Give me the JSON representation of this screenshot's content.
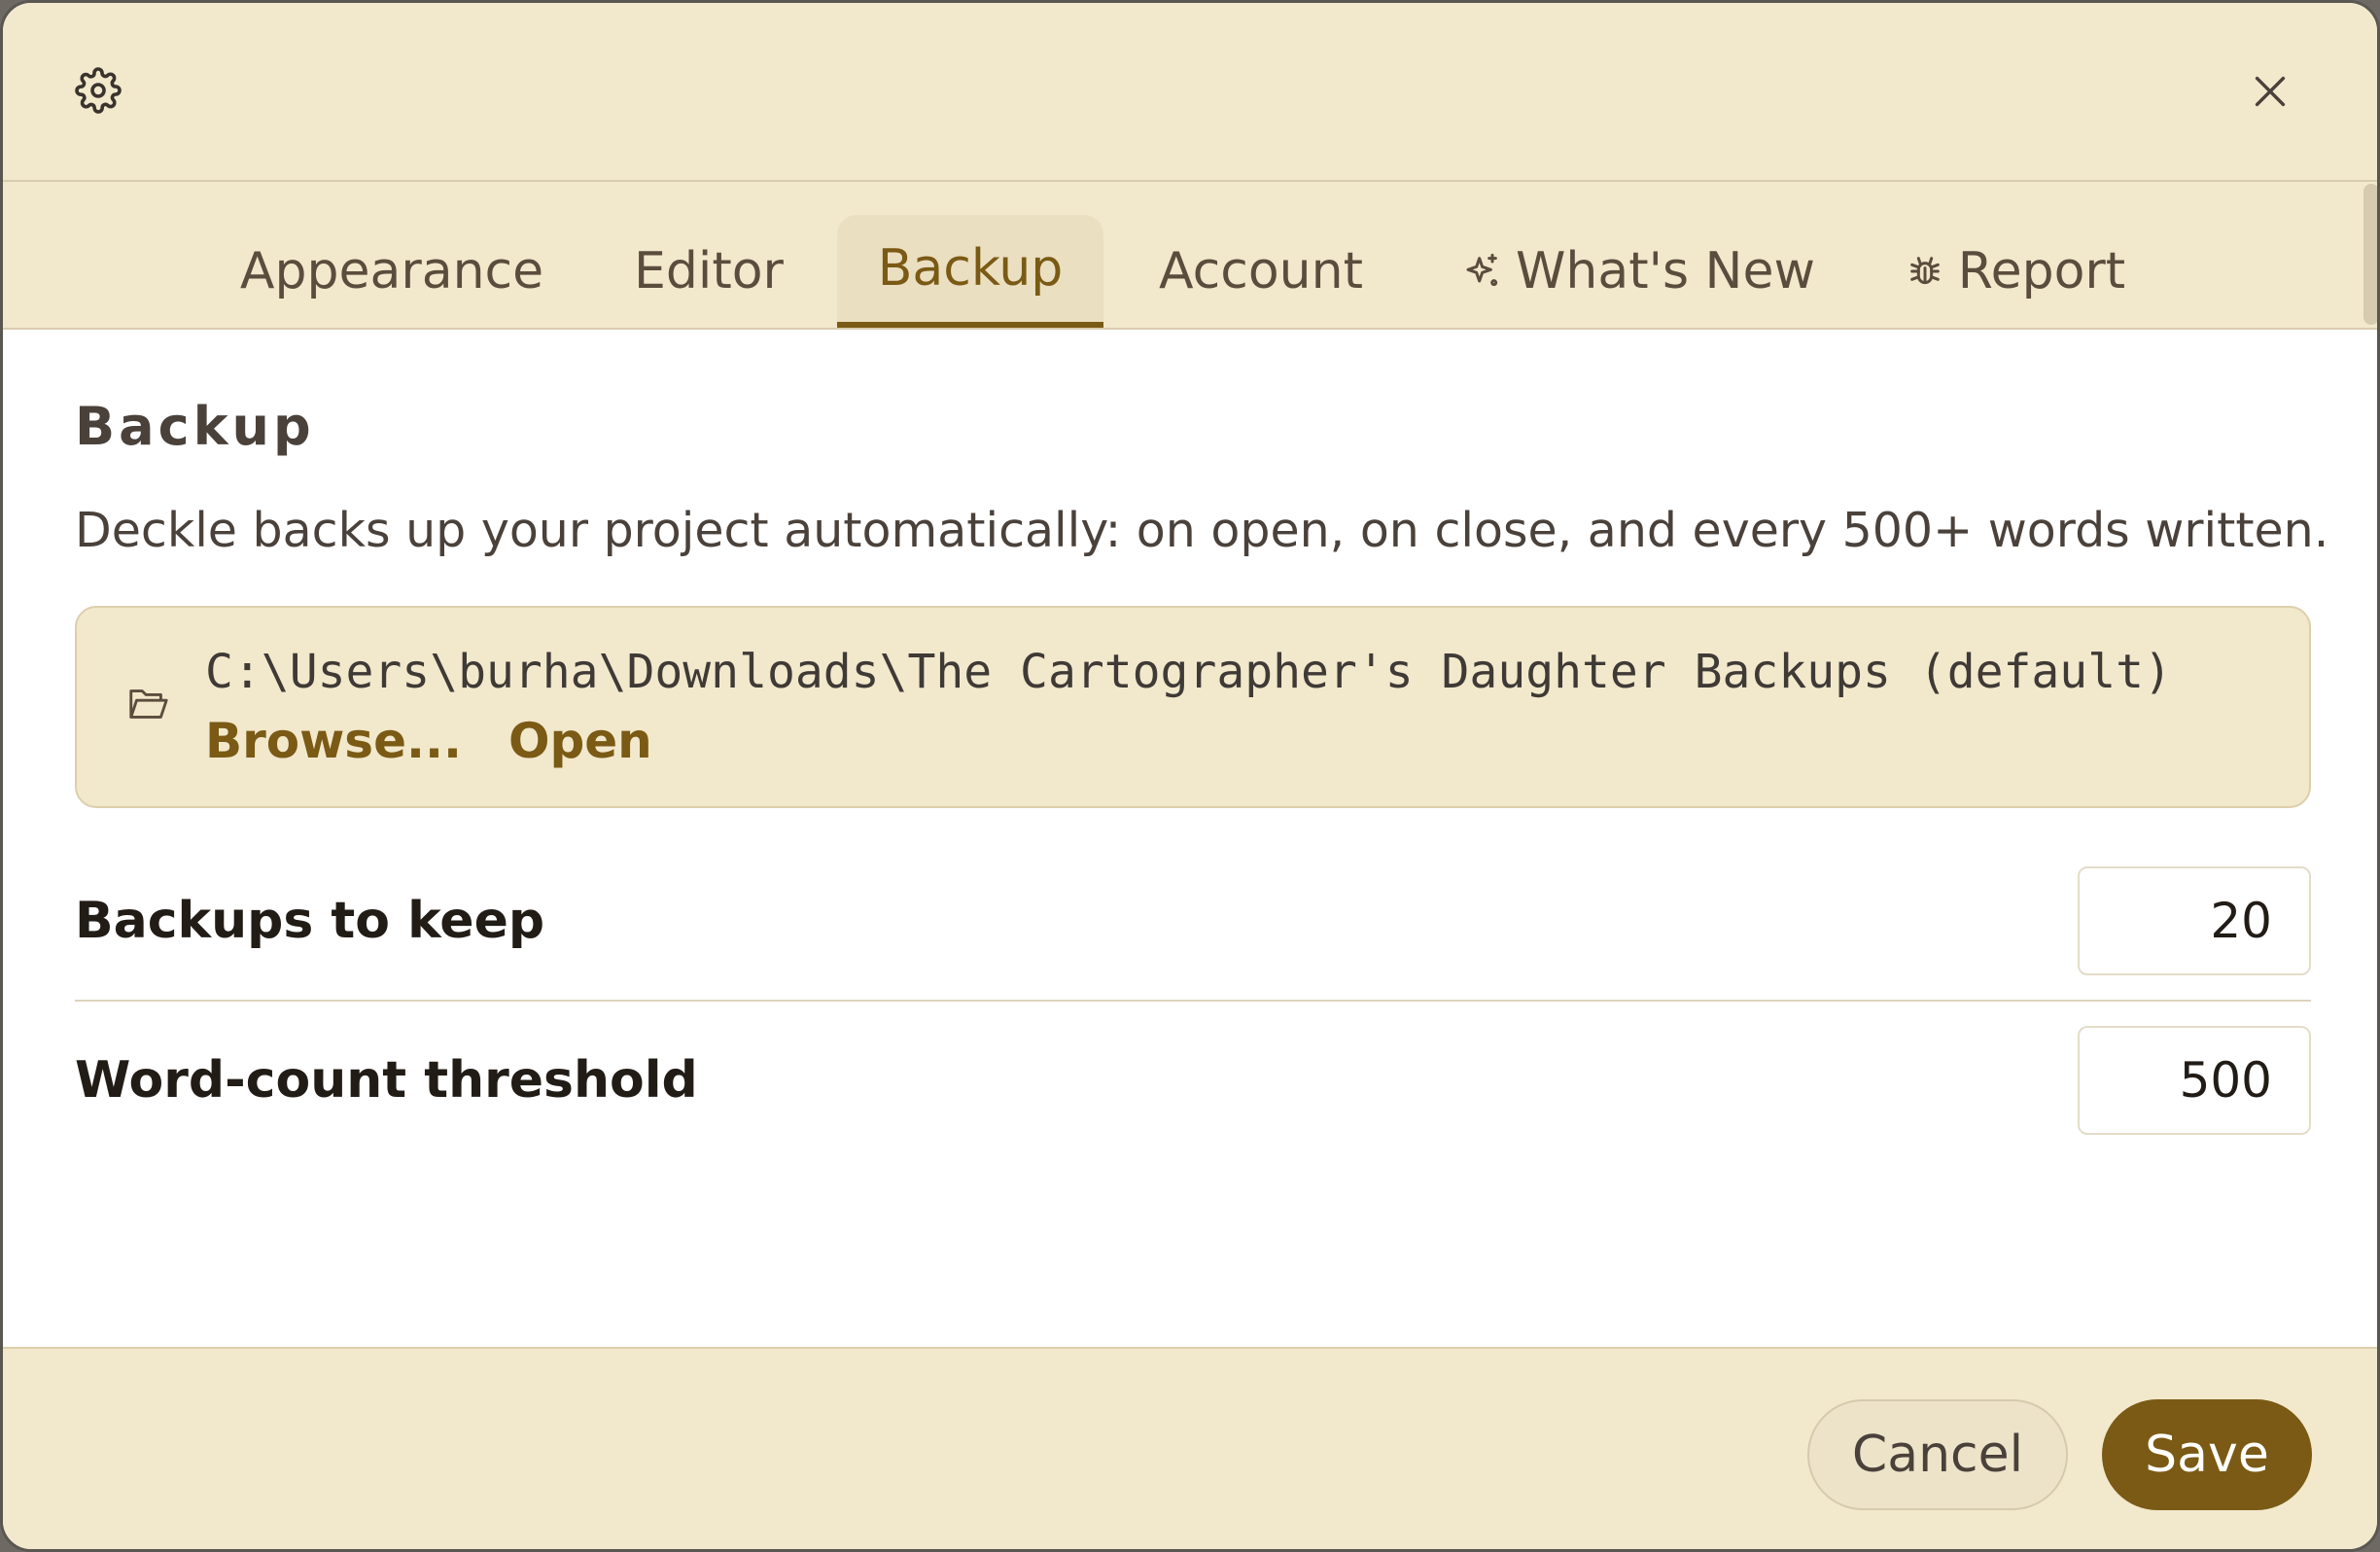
{
  "header": {
    "settings_icon": "gear-icon",
    "close_icon": "close-icon"
  },
  "tabs": [
    {
      "label": "Appearance",
      "active": false
    },
    {
      "label": "Editor",
      "active": false
    },
    {
      "label": "Backup",
      "active": true
    },
    {
      "label": "Account",
      "active": false
    },
    {
      "label": "What's New",
      "icon": "sparkle-icon",
      "active": false
    },
    {
      "label": "Report",
      "icon": "bug-icon",
      "active": false
    }
  ],
  "backup": {
    "title": "Backup",
    "description": "Deckle backs up your project automatically: on open, on close, and every 500+ words written.",
    "path": "C:\\Users\\burha\\Downloads\\The Cartographer's Daughter Backups (default)",
    "browse_label": "Browse...",
    "open_label": "Open",
    "backups_to_keep_label": "Backups to keep",
    "backups_to_keep_value": "20",
    "word_threshold_label": "Word-count threshold",
    "word_threshold_value": "500"
  },
  "footer": {
    "cancel_label": "Cancel",
    "save_label": "Save"
  },
  "colors": {
    "accent": "#7a5a14",
    "panel_bg": "#f2e8cc",
    "text": "#4a413b"
  }
}
